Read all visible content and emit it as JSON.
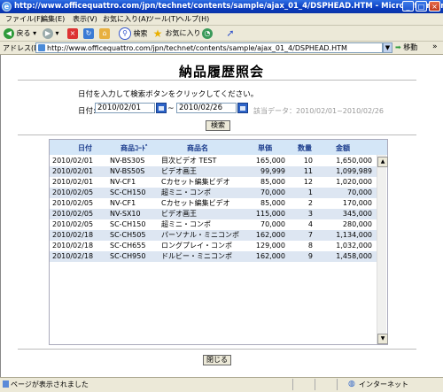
{
  "window": {
    "title": "http://www.officequattro.com/jpn/technet/contents/sample/ajax_01_4/DSPHEAD.HTM - Microsoft Internet Explorer"
  },
  "menu": [
    "ファイル(F)",
    "編集(E)",
    "表示(V)",
    "お気に入り(A)",
    "ツール(T)",
    "ヘルプ(H)"
  ],
  "toolbar": {
    "back": "戻る",
    "search": "検索",
    "favorites": "お気に入り"
  },
  "address": {
    "label": "アドレス(D)",
    "url": "http://www.officequattro.com/jpn/technet/contents/sample/ajax_01_4/DSPHEAD.HTM",
    "go": "移動",
    "links": "»"
  },
  "page": {
    "heading": "納品履歴照会",
    "instruction": "日付を入力して検索ボタンをクリックしてください。",
    "date_label": "日付:",
    "date_from": "2010/02/01",
    "tilde": "~",
    "date_to": "2010/02/26",
    "range_note": "該当データ：2010/02/01~2010/02/26",
    "search_button": "検索",
    "close_button": "閉じる"
  },
  "table": {
    "columns": [
      "日付",
      "商品ｺｰﾄﾞ",
      "商品名",
      "単価",
      "数量",
      "金額"
    ],
    "rows": [
      [
        "2010/02/01",
        "NV-BS30S",
        "目次ビデオ TEST",
        "165,000",
        "10",
        "1,650,000"
      ],
      [
        "2010/02/01",
        "NV-BS50S",
        "ビデオ画王",
        "99,999",
        "11",
        "1,099,989"
      ],
      [
        "2010/02/01",
        "NV-CF1",
        "Cカセット編集ビデオ",
        "85,000",
        "12",
        "1,020,000"
      ],
      [
        "2010/02/05",
        "SC-CH150",
        "超ミニ・コンポ",
        "70,000",
        "1",
        "70,000"
      ],
      [
        "2010/02/05",
        "NV-CF1",
        "Cカセット編集ビデオ",
        "85,000",
        "2",
        "170,000"
      ],
      [
        "2010/02/05",
        "NV-SX10",
        "ビデオ画王",
        "115,000",
        "3",
        "345,000"
      ],
      [
        "2010/02/05",
        "SC-CH150",
        "超ミニ・コンポ",
        "70,000",
        "4",
        "280,000"
      ],
      [
        "2010/02/18",
        "SC-CH505",
        "パーソナル・ミニコンポ",
        "162,000",
        "7",
        "1,134,000"
      ],
      [
        "2010/02/18",
        "SC-CH655",
        "ロングプレイ・コンポ",
        "129,000",
        "8",
        "1,032,000"
      ],
      [
        "2010/02/18",
        "SC-CH950",
        "ドルビー・ミニコンポ",
        "162,000",
        "9",
        "1,458,000"
      ]
    ]
  },
  "status": {
    "text": "ページが表示されました",
    "zone": "インターネット"
  }
}
